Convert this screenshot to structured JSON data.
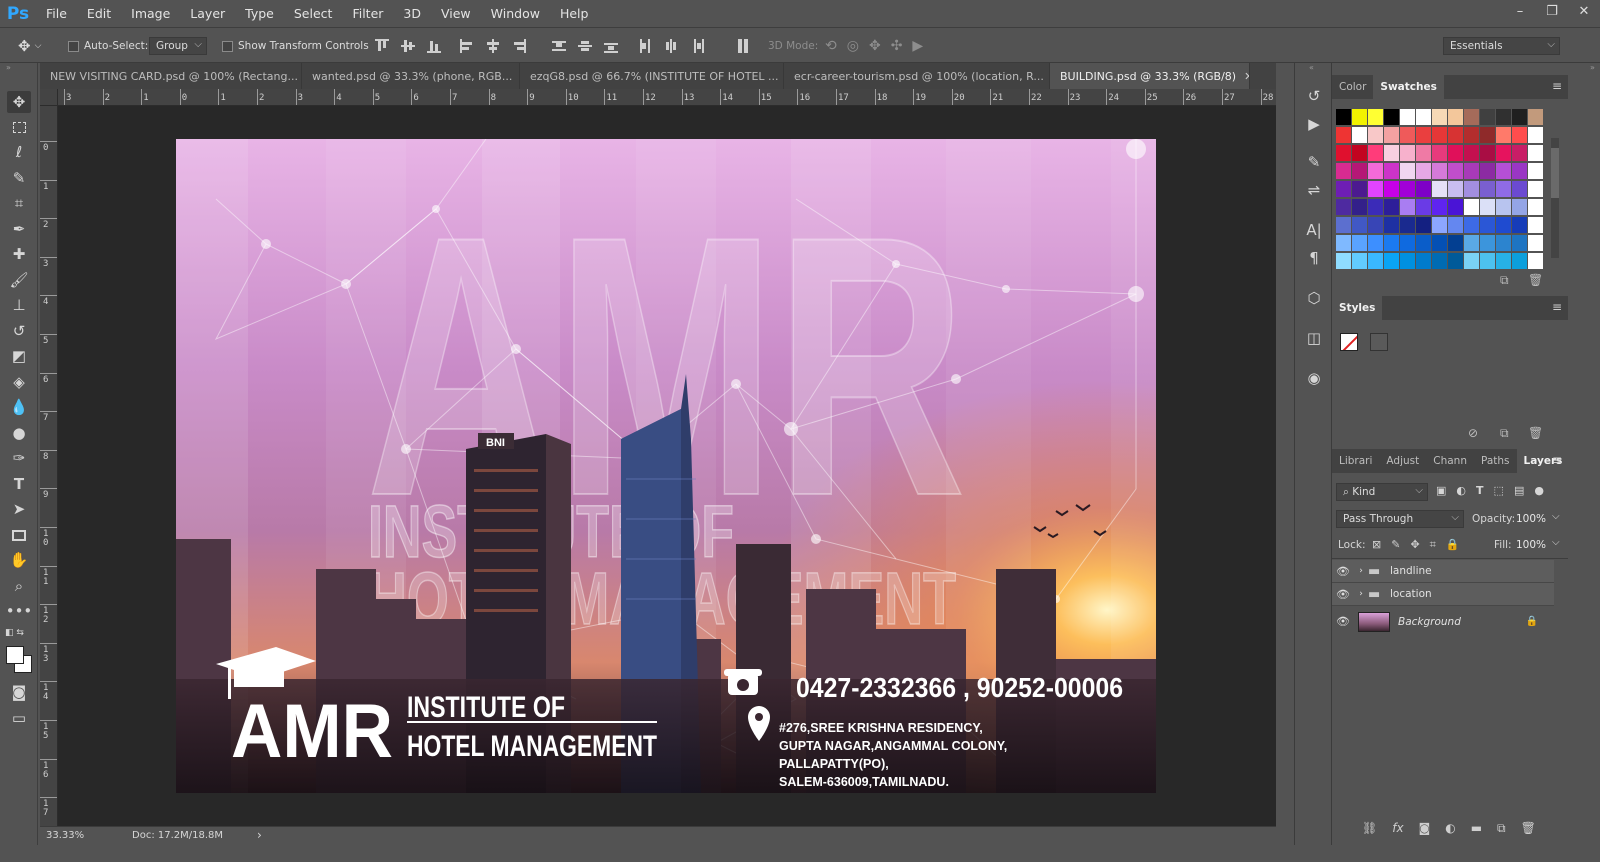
{
  "app": {
    "logo": "Ps"
  },
  "menu": [
    "File",
    "Edit",
    "Image",
    "Layer",
    "Type",
    "Select",
    "Filter",
    "3D",
    "View",
    "Window",
    "Help"
  ],
  "window_controls": {
    "minimize": "–",
    "restore": "❐",
    "close": "✕"
  },
  "options": {
    "auto_select_label": "Auto-Select:",
    "auto_select_value": "Group",
    "transform_label": "Show Transform Controls",
    "mode_3d_label": "3D Mode:",
    "workspace": "Essentials"
  },
  "tabs": [
    {
      "label": "NEW VISITING CARD.psd @ 100% (Rectang...",
      "close": "✕",
      "active": false
    },
    {
      "label": "wanted.psd @ 33.3% (phone, RGB...",
      "close": "✕",
      "active": false
    },
    {
      "label": "ezqG8.psd @ 66.7% (INSTITUTE OF  HOTEL ...",
      "close": "✕",
      "active": false
    },
    {
      "label": "ecr-career-tourism.psd @ 100% (location, R...",
      "close": "✕",
      "active": false
    },
    {
      "label": "BUILDING.psd @ 33.3% (RGB/8)",
      "close": "✕",
      "active": true
    }
  ],
  "hruler_ticks": [
    "3",
    "2",
    "1",
    "0",
    "1",
    "2",
    "3",
    "4",
    "5",
    "6",
    "7",
    "8",
    "9",
    "10",
    "11",
    "12",
    "13",
    "14",
    "15",
    "16",
    "17",
    "18",
    "19",
    "20",
    "21",
    "22",
    "23",
    "24",
    "25",
    "26",
    "27",
    "28"
  ],
  "vruler_ticks": [
    "0",
    "1",
    "2",
    "3",
    "4",
    "5",
    "6",
    "7",
    "8",
    "9",
    "10",
    "11",
    "12",
    "13",
    "14",
    "15",
    "16",
    "17"
  ],
  "status": {
    "zoom": "33.33%",
    "doc": "Doc: 17.2M/18.8M",
    "arrow": "›"
  },
  "document": {
    "bg_letters": "AMR",
    "bg_line1": "INSTITUTE OF",
    "bg_line2": "HOTEL MANAGEMENT",
    "building_sign": "BNI",
    "logo_letters": "AMR",
    "logo_line1": "INSTITUTE OF",
    "logo_line2": "HOTEL MANAGEMENT",
    "phone": "0427-2332366 ,  90252-00006",
    "address": [
      "#276,SREE KRISHNA RESIDENCY,",
      "GUPTA NAGAR,ANGAMMAL COLONY,",
      "PALLAPATTY(PO),",
      "SALEM-636009,TAMILNADU."
    ]
  },
  "panels": {
    "color_tabs": [
      "Color",
      "Swatches"
    ],
    "styles_tab": "Styles",
    "layer_tabs": [
      "Librari",
      "Adjust",
      "Chann",
      "Paths",
      "Layers"
    ],
    "filter_kind": "Kind",
    "blend_mode": "Pass Through",
    "opacity_label": "Opacity:",
    "opacity_value": "100%",
    "lock_label": "Lock:",
    "fill_label": "Fill:",
    "fill_value": "100%",
    "layers": [
      {
        "name": "landline",
        "type": "group"
      },
      {
        "name": "location",
        "type": "group"
      },
      {
        "name": "Background",
        "type": "image"
      }
    ]
  },
  "swatch_rows": [
    [
      "#000000",
      "#f2f200",
      "#ffff33",
      "#000000",
      "#ffffff",
      "#ffffff",
      "#f6d9b6",
      "#f3c79b",
      "#a56b5a",
      "#404040",
      "#303030",
      "#202020",
      "#c29a7c"
    ],
    [
      "#ee3433",
      "#ffffff",
      "#f8c8c8",
      "#f3a1a1",
      "#ef5a5a",
      "#ea3f3f",
      "#e63737",
      "#d73333",
      "#b32d2d",
      "#8f2a2a",
      "#ff7a6a",
      "#ff4d4d",
      "#ffffff"
    ],
    [
      "#e0102e",
      "#c20420",
      "#ff3c7a",
      "#f8d0e0",
      "#f7b1cc",
      "#ef7aa5",
      "#e73a7c",
      "#e0105a",
      "#c4104f",
      "#a90d44",
      "#e6135e",
      "#c81e66",
      "#ffffff"
    ],
    [
      "#d82b91",
      "#b51776",
      "#f46ad9",
      "#cc33c9",
      "#f0d6f0",
      "#e6a8e6",
      "#d57ad9",
      "#c04ecb",
      "#a83ab8",
      "#8c2ba3",
      "#b54fd6",
      "#9a36c4",
      "#ffffff"
    ],
    [
      "#6e1eb4",
      "#4c1a90",
      "#e244ff",
      "#c700e6",
      "#a100d8",
      "#7e00c7",
      "#e6e0f7",
      "#c9bdf0",
      "#a28ee0",
      "#7a5fd0",
      "#8f6be6",
      "#6b4ad1",
      "#ffffff"
    ],
    [
      "#4e2aa0",
      "#33208a",
      "#3b2bb8",
      "#2d1e99",
      "#a97df2",
      "#6a3be6",
      "#5f24f0",
      "#4a14d6",
      "#ffffff",
      "#dbe0f7",
      "#b8c4ef",
      "#94a5e6",
      "#ffffff"
    ],
    [
      "#5c6fcf",
      "#4158c5",
      "#3845b6",
      "#1e30a3",
      "#1a2a8f",
      "#142081",
      "#8ca6ff",
      "#6487f0",
      "#3d6ae6",
      "#2b57d6",
      "#1f4bd0",
      "#163cb8",
      "#ffffff"
    ],
    [
      "#7fb9ff",
      "#5aa3ff",
      "#3d8fff",
      "#1b7af0",
      "#0f6ae0",
      "#0a5dc9",
      "#0450b4",
      "#033f91",
      "#5aa9e6",
      "#3c95dc",
      "#2c84cf",
      "#1e74c2",
      "#ffffff"
    ],
    [
      "#8fdcff",
      "#62cbff",
      "#3ab8ff",
      "#0aa4f5",
      "#0090e0",
      "#007bcc",
      "#006bb3",
      "#005a99",
      "#7ad2f5",
      "#4dc2ef",
      "#27b1e6",
      "#0c9fdc",
      "#ffffff"
    ]
  ],
  "colors": {
    "accent": "#31a8ff",
    "ui_bg": "#535353",
    "panel_dark": "#424242",
    "canvas_bg": "#282828"
  }
}
